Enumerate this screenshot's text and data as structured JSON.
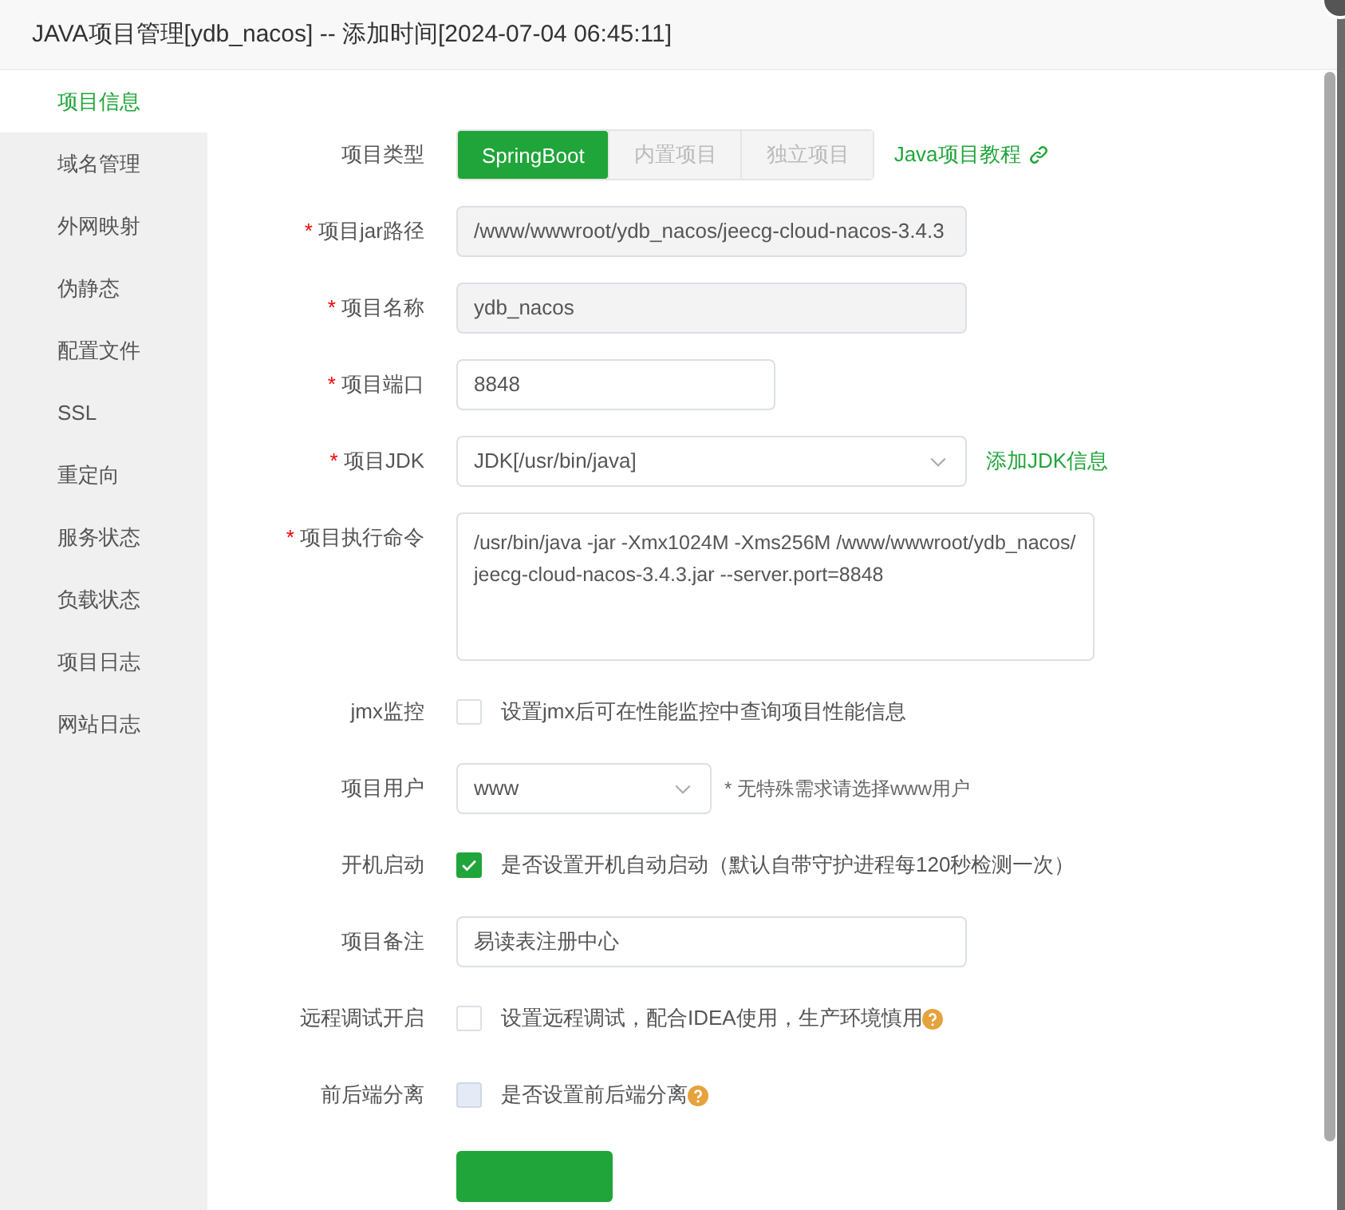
{
  "window": {
    "title": "JAVA项目管理[ydb_nacos] -- 添加时间[2024-07-04 06:45:11]"
  },
  "sidebar": {
    "items": [
      {
        "label": "项目信息",
        "selected": true
      },
      {
        "label": "域名管理",
        "selected": false
      },
      {
        "label": "外网映射",
        "selected": false
      },
      {
        "label": "伪静态",
        "selected": false
      },
      {
        "label": "配置文件",
        "selected": false
      },
      {
        "label": "SSL",
        "selected": false
      },
      {
        "label": "重定向",
        "selected": false
      },
      {
        "label": "服务状态",
        "selected": false
      },
      {
        "label": "负载状态",
        "selected": false
      },
      {
        "label": "项目日志",
        "selected": false
      },
      {
        "label": "网站日志",
        "selected": false
      }
    ]
  },
  "form": {
    "rows": [
      {
        "kind": "segmented",
        "label": "项目类型",
        "options": [
          {
            "label": "SpringBoot",
            "selected": true
          },
          {
            "label": "内置项目",
            "selected": false
          },
          {
            "label": "独立项目",
            "selected": false
          }
        ],
        "link": "Java项目教程"
      },
      {
        "kind": "input",
        "required_mark": "*",
        "label": "项目jar路径",
        "value": "/www/wwwroot/ydb_nacos/jeecg-cloud-nacos-3.4.3",
        "disabled": true
      },
      {
        "kind": "input",
        "required_mark": "*",
        "label": "项目名称",
        "value": "ydb_nacos",
        "disabled": true
      },
      {
        "kind": "input",
        "required_mark": "*",
        "label": "项目端口",
        "value": "8848",
        "disabled": false
      },
      {
        "kind": "select",
        "required_mark": "*",
        "label": "项目JDK",
        "value": "JDK[/usr/bin/java]",
        "link": "添加JDK信息"
      },
      {
        "kind": "textarea",
        "required_mark": "*",
        "label": "项目执行命令",
        "value": "/usr/bin/java  -jar -Xmx1024M -Xms256M  /www/wwwroot/ydb_nacos/jeecg-cloud-nacos-3.4.3.jar --server.port=8848"
      },
      {
        "kind": "checkbox",
        "label": "jmx监控",
        "checked": false,
        "disabled": false,
        "text": "设置jmx后可在性能监控中查询项目性能信息",
        "help": false
      },
      {
        "kind": "select",
        "label": "项目用户",
        "value": "www",
        "hint": "* 无特殊需求请选择www用户"
      },
      {
        "kind": "checkbox",
        "label": "开机启动",
        "checked": true,
        "disabled": false,
        "text": "是否设置开机自动启动（默认自带守护进程每120秒检测一次）",
        "help": false
      },
      {
        "kind": "input",
        "label": "项目备注",
        "value": "易读表注册中心",
        "disabled": false
      },
      {
        "kind": "checkbox",
        "label": "远程调试开启",
        "checked": false,
        "disabled": false,
        "text": "设置远程调试，配合IDEA使用，生产环境慎用",
        "help": true
      },
      {
        "kind": "checkbox",
        "label": "前后端分离",
        "checked": false,
        "disabled": true,
        "text": "是否设置前后端分离",
        "help": true
      }
    ]
  }
}
